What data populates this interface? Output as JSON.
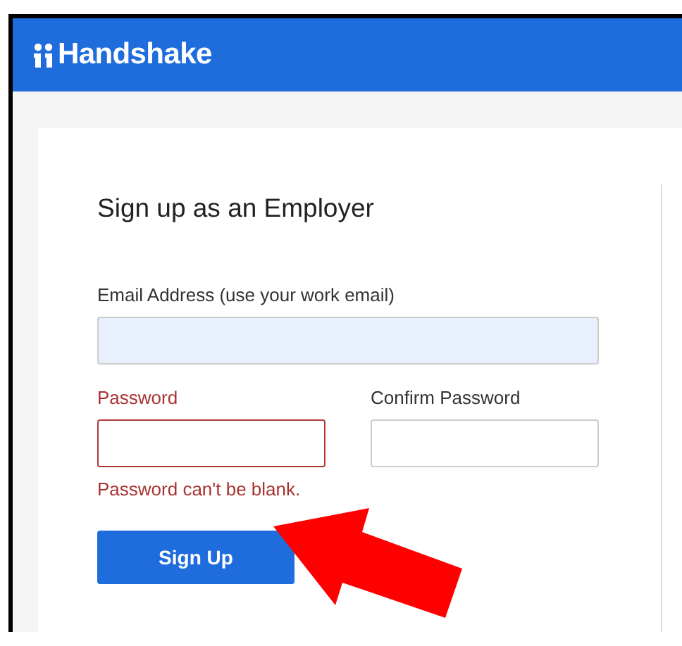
{
  "header": {
    "logo_text": "Handshake"
  },
  "form": {
    "title": "Sign up as an Employer",
    "fields": [
      {
        "label": "Email Address (use your work email)",
        "error": false,
        "autofilled": true
      },
      {
        "label": "Password",
        "error": true,
        "autofilled": false
      },
      {
        "label": "Confirm Password",
        "error": false,
        "autofilled": false
      }
    ],
    "error_message": "Password can't be blank.",
    "submit": "Sign Up"
  },
  "annotation": {
    "kind": "arrow"
  }
}
